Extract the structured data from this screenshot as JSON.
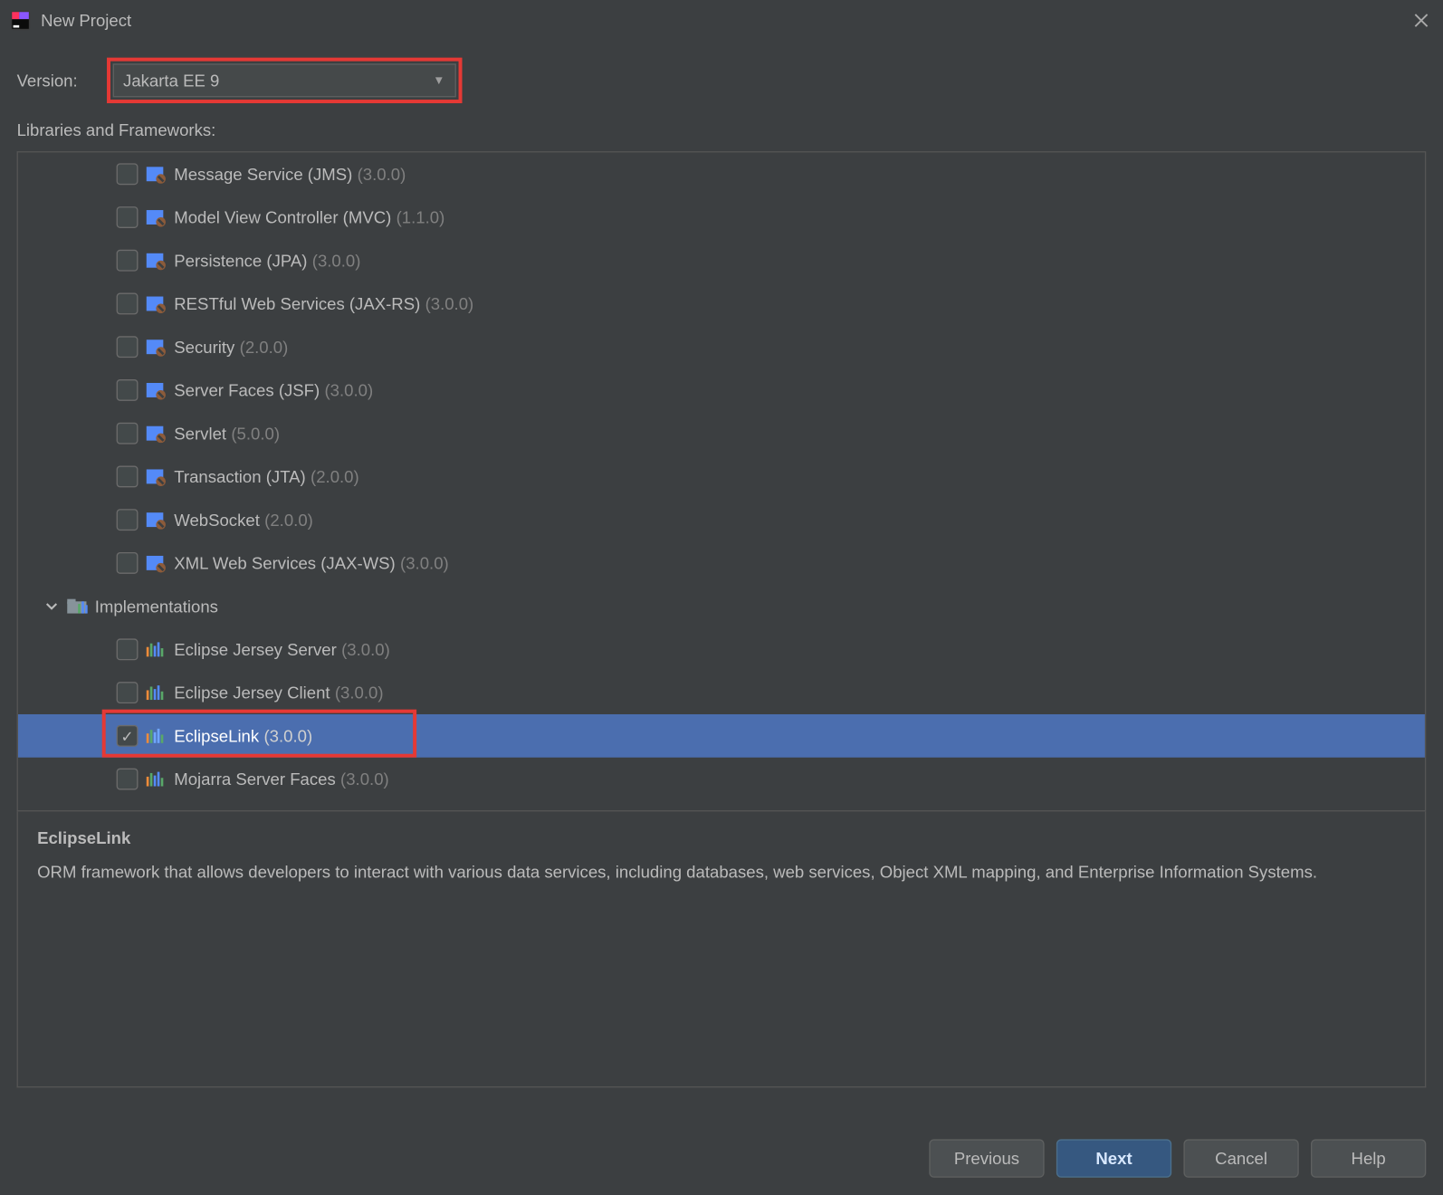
{
  "window": {
    "title": "New Project"
  },
  "version": {
    "label": "Version:",
    "selected": "Jakarta EE 9"
  },
  "sectionLabel": "Libraries and Frameworks:",
  "libraries": [
    {
      "name": "Message Service (JMS)",
      "version": "(3.0.0)",
      "checked": false
    },
    {
      "name": "Model View Controller (MVC)",
      "version": "(1.1.0)",
      "checked": false
    },
    {
      "name": "Persistence (JPA)",
      "version": "(3.0.0)",
      "checked": false
    },
    {
      "name": "RESTful Web Services (JAX-RS)",
      "version": "(3.0.0)",
      "checked": false
    },
    {
      "name": "Security",
      "version": "(2.0.0)",
      "checked": false
    },
    {
      "name": "Server Faces (JSF)",
      "version": "(3.0.0)",
      "checked": false
    },
    {
      "name": "Servlet",
      "version": "(5.0.0)",
      "checked": false
    },
    {
      "name": "Transaction (JTA)",
      "version": "(2.0.0)",
      "checked": false
    },
    {
      "name": "WebSocket",
      "version": "(2.0.0)",
      "checked": false
    },
    {
      "name": "XML Web Services (JAX-WS)",
      "version": "(3.0.0)",
      "checked": false
    }
  ],
  "implGroup": {
    "label": "Implementations"
  },
  "implementations": [
    {
      "name": "Eclipse Jersey Server",
      "version": "(3.0.0)",
      "checked": false,
      "selected": false
    },
    {
      "name": "Eclipse Jersey Client",
      "version": "(3.0.0)",
      "checked": false,
      "selected": false
    },
    {
      "name": "EclipseLink",
      "version": "(3.0.0)",
      "checked": true,
      "selected": true
    },
    {
      "name": "Mojarra Server Faces",
      "version": "(3.0.0)",
      "checked": false,
      "selected": false
    }
  ],
  "description": {
    "title": "EclipseLink",
    "body": "ORM framework that allows developers to interact with various data services, including databases, web services, Object XML mapping, and Enterprise Information Systems."
  },
  "buttons": {
    "previous": "Previous",
    "next": "Next",
    "cancel": "Cancel",
    "help": "Help"
  }
}
